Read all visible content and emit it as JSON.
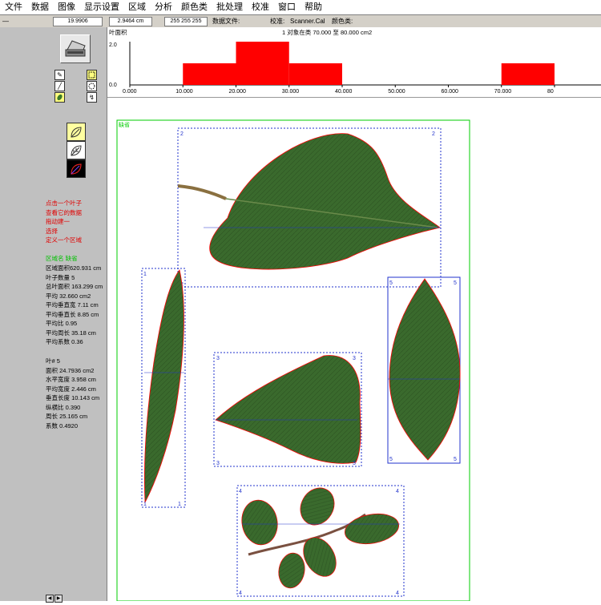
{
  "menu": [
    "文件",
    "数据",
    "图像",
    "显示设置",
    "区域",
    "分析",
    "颜色类",
    "批处理",
    "校准",
    "窗口",
    "帮助"
  ],
  "toolbar": {
    "value1": "19.9906",
    "value2": "2.9464 cm",
    "value3": "255 255 255",
    "data_file_label": "数据文件:",
    "calibration_label": "校准:",
    "calibration_value": "Scanner.Cal",
    "color_class_label": "颜色类:"
  },
  "panel": {
    "instructions": [
      "点击一个叶子",
      "查看它的数据",
      "拖动建一",
      "选择",
      "定义一个区域"
    ],
    "region_title": "区域名 缺省",
    "summary": [
      "区域面积620.931 cm",
      "叶子数量 5",
      "总叶面积 163.299 cm",
      "平均 32.660 cm2",
      "平均垂直宽 7.11 cm",
      "平均垂直长 8.85 cm",
      "平均比 0.95",
      "平均周长 35.18 cm",
      "平均系数 0.36"
    ],
    "leaf_detail": [
      "叶# 5",
      "面积 24.7936 cm2",
      "水平宽度 3.958 cm",
      "平均宽度 2.446 cm",
      "垂直长度 10.143 cm",
      "纵横比 0.390",
      "周长 25.165 cm",
      "系数 0.4920"
    ]
  },
  "chart_data": {
    "type": "bar",
    "title": "1 对象在类 70.000 至 80.000 cm2",
    "ylabel": "叶面积",
    "x_ticks": [
      "0.000",
      "10.000",
      "20.000",
      "30.000",
      "40.000",
      "50.000",
      "60.000",
      "70.000",
      "80"
    ],
    "y_ticks": [
      "2.0",
      "0.0"
    ],
    "ylim": [
      0,
      2
    ],
    "bins": [
      {
        "from": 0,
        "to": 10,
        "count": 0
      },
      {
        "from": 10,
        "to": 20,
        "count": 1
      },
      {
        "from": 20,
        "to": 30,
        "count": 2
      },
      {
        "from": 30,
        "to": 40,
        "count": 1
      },
      {
        "from": 40,
        "to": 50,
        "count": 0
      },
      {
        "from": 50,
        "to": 60,
        "count": 0
      },
      {
        "from": 60,
        "to": 70,
        "count": 0
      },
      {
        "from": 70,
        "to": 80,
        "count": 1
      }
    ],
    "bar_color": "#ff0000"
  },
  "region": {
    "name": "缺省",
    "color": "#00cc00"
  },
  "leaf_labels": {
    "one": "1",
    "two": "2",
    "three": "3",
    "four": "4",
    "five": "5"
  },
  "colors": {
    "box": "#2233cc",
    "leaf_dark": "#2f5a25",
    "leaf_mid": "#3d6e2f",
    "outline": "#ff0000"
  }
}
